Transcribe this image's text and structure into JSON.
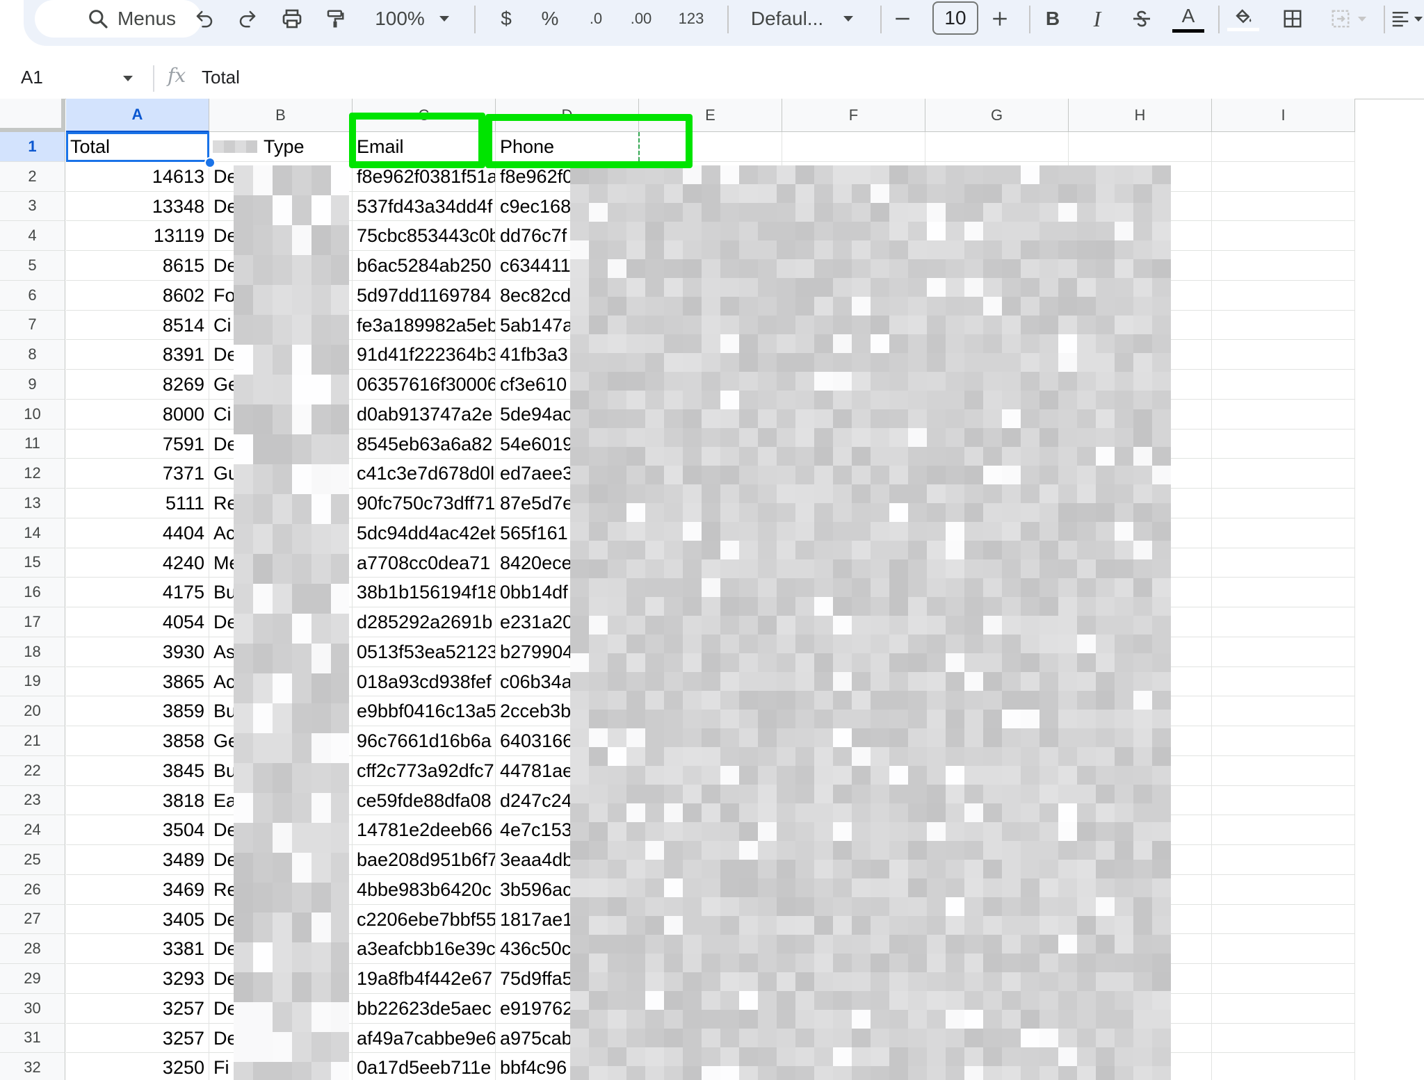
{
  "toolbar": {
    "search_label": "Menus",
    "zoom": "100%",
    "currency": "$",
    "percent": "%",
    "decrease_decimal": ".0",
    "increase_decimal": ".00",
    "number_format": "123",
    "font_family": "Defaul...",
    "font_size": "10",
    "bold": "B",
    "italic": "I",
    "text_color_letter": "A"
  },
  "formula_bar": {
    "cell_ref": "A1",
    "fx": "fx",
    "content": "Total"
  },
  "columns": [
    "A",
    "B",
    "C",
    "D",
    "E",
    "F",
    "G",
    "H",
    "I"
  ],
  "header_row": {
    "total": "Total",
    "type": "Type",
    "email": "Email",
    "phone": "Phone"
  },
  "rows": [
    {
      "n": "2",
      "total": "14613",
      "type": "De",
      "email": "f8e962f0381f51a",
      "phone": "f8e962f0"
    },
    {
      "n": "3",
      "total": "13348",
      "type": "De",
      "email": "537fd43a34dd4f",
      "phone": "c9ec168"
    },
    {
      "n": "4",
      "total": "13119",
      "type": "De",
      "email": "75cbc853443c0b",
      "phone": "dd76c7f"
    },
    {
      "n": "5",
      "total": "8615",
      "type": "De",
      "email": "b6ac5284ab250",
      "phone": "c634411"
    },
    {
      "n": "6",
      "total": "8602",
      "type": "Fo",
      "email": "5d97dd1169784",
      "phone": "8ec82cd"
    },
    {
      "n": "7",
      "total": "8514",
      "type": "Ci",
      "email": "fe3a189982a5eb",
      "phone": "5ab147a"
    },
    {
      "n": "8",
      "total": "8391",
      "type": "De",
      "email": "91d41f222364b3",
      "phone": "41fb3a3"
    },
    {
      "n": "9",
      "total": "8269",
      "type": "Ge",
      "email": "06357616f30006",
      "phone": "cf3e610"
    },
    {
      "n": "10",
      "total": "8000",
      "type": "Ci",
      "email": "d0ab913747a2e",
      "phone": "5de94ac"
    },
    {
      "n": "11",
      "total": "7591",
      "type": "De",
      "email": "8545eb63a6a82",
      "phone": "54e6019"
    },
    {
      "n": "12",
      "total": "7371",
      "type": "Gu",
      "email": "c41c3e7d678d0l",
      "phone": "ed7aee3"
    },
    {
      "n": "13",
      "total": "5111",
      "type": "Re",
      "email": "90fc750c73dff71",
      "phone": "87e5d7e"
    },
    {
      "n": "14",
      "total": "4404",
      "type": "Ac",
      "email": "5dc94dd4ac42eb",
      "phone": "565f161"
    },
    {
      "n": "15",
      "total": "4240",
      "type": "Me",
      "email": "a7708cc0dea71",
      "phone": "8420ece"
    },
    {
      "n": "16",
      "total": "4175",
      "type": "Bu",
      "email": "38b1b156194f18",
      "phone": "0bb14df"
    },
    {
      "n": "17",
      "total": "4054",
      "type": "De",
      "email": "d285292a2691b",
      "phone": "e231a20"
    },
    {
      "n": "18",
      "total": "3930",
      "type": "As",
      "email": "0513f53ea52123",
      "phone": "b279904"
    },
    {
      "n": "19",
      "total": "3865",
      "type": "Ac",
      "email": "018a93cd938fef",
      "phone": "c06b34a"
    },
    {
      "n": "20",
      "total": "3859",
      "type": "Bu",
      "email": "e9bbf0416c13a5",
      "phone": "2cceb3b"
    },
    {
      "n": "21",
      "total": "3858",
      "type": "Ge",
      "email": "96c7661d16b6a",
      "phone": "6403166"
    },
    {
      "n": "22",
      "total": "3845",
      "type": "Bu",
      "email": "cff2c773a92dfc7",
      "phone": "44781ae"
    },
    {
      "n": "23",
      "total": "3818",
      "type": "Ea",
      "email": "ce59fde88dfa08",
      "phone": "d247c24"
    },
    {
      "n": "24",
      "total": "3504",
      "type": "De",
      "email": "14781e2deeb66",
      "phone": "4e7c153"
    },
    {
      "n": "25",
      "total": "3489",
      "type": "De",
      "email": "bae208d951b6f7",
      "phone": "3eaa4db"
    },
    {
      "n": "26",
      "total": "3469",
      "type": "Re",
      "email": "4bbe983b6420c",
      "phone": "3b596ac"
    },
    {
      "n": "27",
      "total": "3405",
      "type": "De",
      "email": "c2206ebe7bbf55",
      "phone": "1817ae1"
    },
    {
      "n": "28",
      "total": "3381",
      "type": "De",
      "email": "a3eafcbb16e39c",
      "phone": "436c50c"
    },
    {
      "n": "29",
      "total": "3293",
      "type": "De",
      "email": "19a8fb4f442e67",
      "phone": "75d9ffa5"
    },
    {
      "n": "30",
      "total": "3257",
      "type": "De",
      "email": "bb22623de5aec",
      "phone": "e919762"
    },
    {
      "n": "31",
      "total": "3257",
      "type": "De",
      "email": "af49a7cabbe9e6",
      "phone": "a975cab"
    },
    {
      "n": "32",
      "total": "3250",
      "type": "Fi",
      "email": "0a17d5eeb711e",
      "phone": "bbf4c96"
    }
  ],
  "colors": {
    "toolbar_bg": "#edf2fa",
    "selection_blue": "#1a73e8",
    "highlight_green": "#00e400",
    "redaction_gray": "#cccccc"
  },
  "icons": [
    "search-icon",
    "undo-icon",
    "redo-icon",
    "print-icon",
    "paint-format-icon",
    "chevron-down-icon",
    "minus-icon",
    "plus-icon",
    "strikethrough-icon",
    "fill-color-icon",
    "borders-icon",
    "merge-cells-icon",
    "align-icon"
  ]
}
